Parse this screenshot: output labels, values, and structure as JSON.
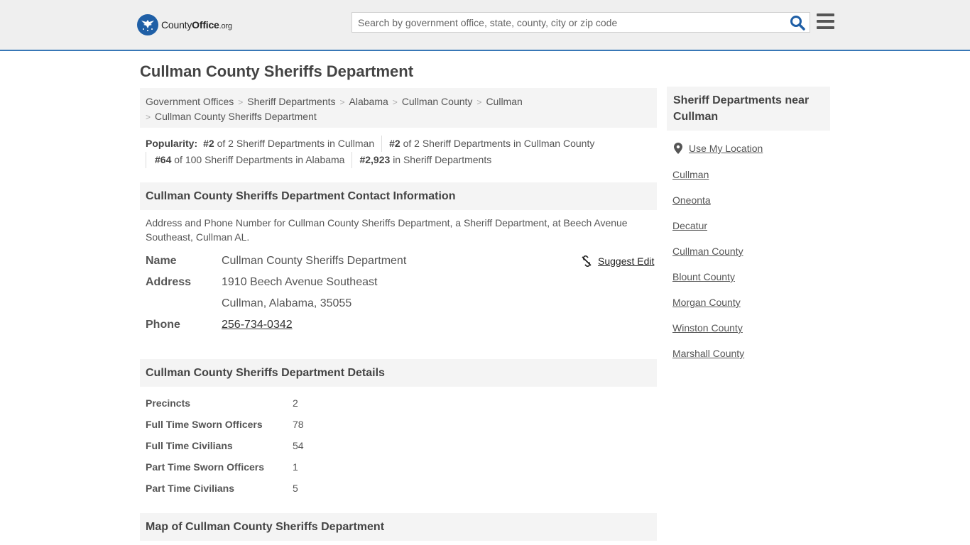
{
  "header": {
    "logo_brand": "County",
    "logo_bold": "Office",
    "logo_tld": ".org",
    "search_placeholder": "Search by government office, state, county, city or zip code",
    "accent_color": "#3877b6"
  },
  "page": {
    "title": "Cullman County Sheriffs Department"
  },
  "breadcrumb": {
    "items": [
      "Government Offices",
      "Sheriff Departments",
      "Alabama",
      "Cullman County",
      "Cullman",
      "Cullman County Sheriffs Department"
    ]
  },
  "popularity": {
    "label": "Popularity:",
    "items": [
      {
        "rank": "#2",
        "text": "of 2 Sheriff Departments in Cullman"
      },
      {
        "rank": "#2",
        "text": "of 2 Sheriff Departments in Cullman County"
      },
      {
        "rank": "#64",
        "text": "of 100 Sheriff Departments in Alabama"
      },
      {
        "rank": "#2,923",
        "text": "in Sheriff Departments"
      }
    ]
  },
  "contact": {
    "heading": "Cullman County Sheriffs Department Contact Information",
    "description": "Address and Phone Number for Cullman County Sheriffs Department, a Sheriff Department, at Beech Avenue Southeast, Cullman AL.",
    "suggest_edit": "Suggest Edit",
    "name_label": "Name",
    "name_value": "Cullman County Sheriffs Department",
    "address_label": "Address",
    "address_line1": "1910 Beech Avenue Southeast",
    "address_line2": "Cullman, Alabama, 35055",
    "phone_label": "Phone",
    "phone_value": "256-734-0342"
  },
  "details": {
    "heading": "Cullman County Sheriffs Department Details",
    "rows": [
      {
        "label": "Precincts",
        "value": "2"
      },
      {
        "label": "Full Time Sworn Officers",
        "value": "78"
      },
      {
        "label": "Full Time Civilians",
        "value": "54"
      },
      {
        "label": "Part Time Sworn Officers",
        "value": "1"
      },
      {
        "label": "Part Time Civilians",
        "value": "5"
      }
    ]
  },
  "map": {
    "heading": "Map of Cullman County Sheriffs Department"
  },
  "sidebar": {
    "heading": "Sheriff Departments near Cullman",
    "use_location": "Use My Location",
    "links": [
      "Cullman",
      "Oneonta",
      "Decatur",
      "Cullman County",
      "Blount County",
      "Morgan County",
      "Winston County",
      "Marshall County"
    ]
  }
}
